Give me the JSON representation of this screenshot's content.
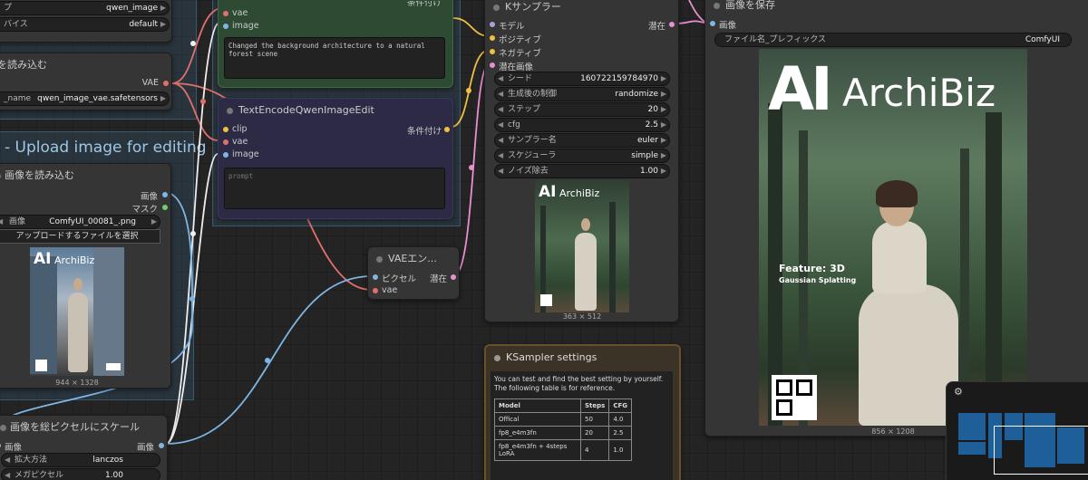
{
  "nodes": {
    "top_left_frag": {
      "widget1_label": "プ",
      "widget1_value": "qwen_image",
      "widget2_label": "バイス",
      "widget2_value": "default"
    },
    "vae_loader": {
      "title": "を読み込む",
      "output_vae": "VAE",
      "widget_label": "_name",
      "widget_value": "qwen_image_vae.safetensors"
    },
    "group_upload_title": "- Upload image for editing",
    "load_image": {
      "title": "画像を読み込む",
      "out_image": "画像",
      "out_mask": "マスク",
      "widget_label": "画像",
      "widget_value": "ComfyUI_00081_.png",
      "upload_button": "アップロードするファイルを選択",
      "caption": "944 × 1328"
    },
    "scale_node": {
      "title": "画像を総ピクセルにスケール",
      "in_image": "画像",
      "out_image": "画像",
      "w1_label": "拡大方法",
      "w1_value": "lanczos",
      "w2_label": "メガピクセル",
      "w2_value": "1.00"
    },
    "text_encode_pos": {
      "in_vae": "vae",
      "in_image": "image",
      "prompt": "Changed the background architecture to a natural forest scene",
      "out_cond_partial": "条件付け"
    },
    "text_encode_neg": {
      "title": "TextEncodeQwenImageEdit",
      "in_clip": "clip",
      "in_vae": "vae",
      "in_image": "image",
      "out_cond": "条件付け",
      "placeholder": "prompt"
    },
    "vae_encode": {
      "title": "VAEエン...",
      "in_pixels": "ピクセル",
      "in_vae": "vae",
      "out_latent": "潜在"
    },
    "ksampler": {
      "title": "Kサンプラー",
      "in_model": "モデル",
      "in_positive": "ポジティブ",
      "in_negative": "ネガティブ",
      "in_latent": "潜在画像",
      "out_latent": "潜在",
      "widgets": [
        {
          "label": "シード",
          "value": "160722159784970"
        },
        {
          "label": "生成後の制御",
          "value": "randomize"
        },
        {
          "label": "ステップ",
          "value": "20"
        },
        {
          "label": "cfg",
          "value": "2.5"
        },
        {
          "label": "サンプラー名",
          "value": "euler"
        },
        {
          "label": "スケジューラ",
          "value": "simple"
        },
        {
          "label": "ノイズ除去",
          "value": "1.00"
        }
      ],
      "caption": "363 × 512"
    },
    "ksampler_settings": {
      "title": "KSampler settings",
      "description": "You can test and find the best setting by yourself. The following table is for reference.",
      "headers": [
        "Model",
        "Steps",
        "CFG"
      ],
      "rows": [
        [
          "Offical",
          "50",
          "4.0"
        ],
        [
          "fp8_e4m3fn",
          "20",
          "2.5"
        ],
        [
          "fp8_e4m3fn + 4steps LoRA",
          "4",
          "1.0"
        ]
      ]
    },
    "save_image": {
      "title": "画像を保存",
      "in_image": "画像",
      "widget_label": "ファイル名_プレフィックス",
      "widget_value": "ComfyUI",
      "caption": "856 × 1208"
    }
  },
  "poster": {
    "logo_ai": "AI",
    "logo_biz": "ArchiBiz",
    "feature_title": "Feature: 3D",
    "feature_sub": "Gaussian Splatting"
  },
  "colors": {
    "link_blue": "#7fb6e6",
    "link_yellow": "#f0c040",
    "link_red": "#e07070",
    "link_pink": "#e890d0",
    "link_white": "#eeeeee",
    "group_green": "#2f4a33",
    "group_purple": "#2c2a45",
    "settings_border": "#6b4f2a"
  }
}
